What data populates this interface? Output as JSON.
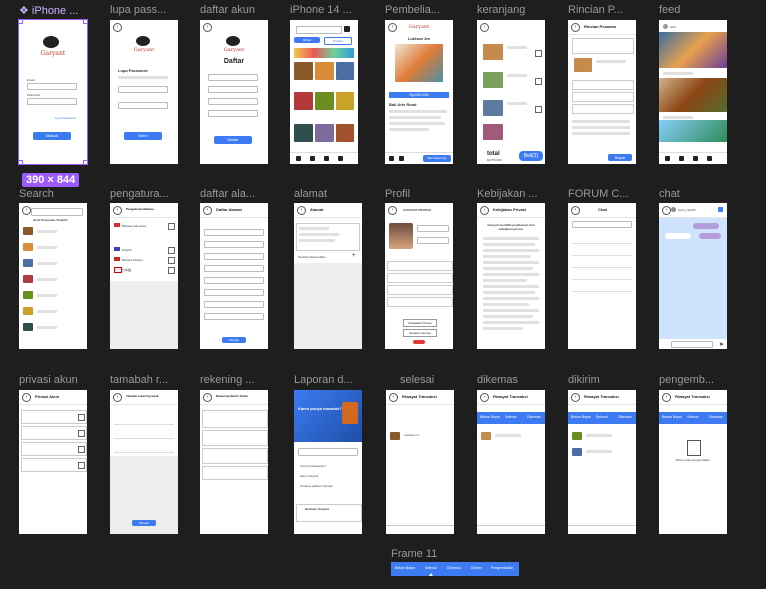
{
  "canvas": {
    "selected_size": "390 × 844",
    "row1": [
      {
        "label": "❖ iPhone ..."
      },
      {
        "label": "lupa pass..."
      },
      {
        "label": "daftar akun"
      },
      {
        "label": "iPhone 14 ..."
      },
      {
        "label": "Pembelia..."
      },
      {
        "label": "keranjang"
      },
      {
        "label": "Rincian P..."
      },
      {
        "label": "feed"
      }
    ],
    "row2": [
      {
        "label": "Search"
      },
      {
        "label": "pengatura..."
      },
      {
        "label": "daftar ala..."
      },
      {
        "label": "alamat"
      },
      {
        "label": "Profil"
      },
      {
        "label": "Kebijakan ..."
      },
      {
        "label": "FORUM C..."
      },
      {
        "label": "chat"
      }
    ],
    "row3": [
      {
        "label": "privasi akun"
      },
      {
        "label": "tamabah r..."
      },
      {
        "label": "rekening ..."
      },
      {
        "label": "Laporan d..."
      },
      {
        "label": "selesai"
      },
      {
        "label": "dikemas"
      },
      {
        "label": "dikirim"
      },
      {
        "label": "pengemb..."
      }
    ],
    "frame11": {
      "label": "Frame 11",
      "tabs": [
        "Belum Bayar",
        "Selesai",
        "Dikemas",
        "Dikirim",
        "Pengembalian"
      ]
    }
  },
  "screens": {
    "login": {
      "brand": "Garyant",
      "btn": "Masuk",
      "forgot": "Lupa Password",
      "email_label": "Email",
      "password_label": "Password"
    },
    "forgot": {
      "brand": "Garyant",
      "title": "Lupa Password",
      "btn": "Kirim"
    },
    "daftar": {
      "brand": "Garyant",
      "title": "Daftar",
      "btn": "Daftar"
    },
    "home": {
      "search": "Cari",
      "tab1": "Dilihat",
      "tab2": "Terbaru"
    },
    "pembelian": {
      "brand": "Garyant",
      "title": "Lukisan 2m",
      "price": "Rp250.000",
      "shop": "Bali Arts Road",
      "btn": "Beli Sekarang"
    },
    "keranjang": {
      "title": "keranjang",
      "total": "total",
      "total_val": "Rp750.000",
      "btn": "Beli(2)"
    },
    "rincian": {
      "title": "Rincian Pesanan",
      "btn": "Bayar"
    },
    "feed": {
      "user": "Sisil"
    },
    "search": {
      "title": "Hasil Pencarian Terakhir"
    },
    "pengaturan": {
      "title": "Pengaturan Bahasa",
      "opt1": "Bahasa Indonesia",
      "opt2": "English",
      "opt3": "Bahasa Melayu",
      "opt4": "日本語"
    },
    "daftaralamat": {
      "title": "Daftar Alamat",
      "btn": "Simpan"
    },
    "alamat": {
      "title": "Alamat",
      "add": "Tambah Alamat Baru"
    },
    "profil": {
      "title": "GARYANT PROFILE",
      "btn1": "Kebijakan Privasi",
      "btn2": "Setelan Lainnya"
    },
    "kebijakan": {
      "title": "Kebijakan Privasi",
      "heading": "Garyant memiliki pembaruan dan kebijakan privasi"
    },
    "forum": {
      "title": "Chat"
    },
    "chat": {
      "user": "Garry_SHOP"
    },
    "privasi": {
      "title": "Privasi Akun"
    },
    "tambahrek": {
      "title": "Tambah rekening bank",
      "btn": "Simpan"
    },
    "rekening": {
      "title": "Rekening Bank / Kartu"
    },
    "laporan": {
      "banner": "Kamu punya masalah?",
      "item1": "Cara Pembayaran?",
      "item2": "Akun Garyant",
      "item3": "Tentang aplikasi Garyant",
      "footer": "Bantuan Garyant"
    },
    "selesai": {
      "title": "Riwayat Transaksi",
      "item": "Lukisan 2m"
    },
    "dikemas": {
      "title": "Riwayat Transaksi",
      "tab_a": "Belum Bayar",
      "tab_b": "Selesai",
      "tab_c": "Dikemas"
    },
    "dikirim": {
      "title": "Riwayat Transaksi",
      "tab_a": "Belum Bayar",
      "tab_b": "Selesai",
      "tab_c": "Dikemas"
    },
    "pengembalian": {
      "title": "Riwayat Transaksi",
      "tab_a": "Belum Bayar",
      "tab_b": "Selesai",
      "tab_c": "Dikemas",
      "empty": "Belum ada pengembalian"
    }
  },
  "colors": {
    "accent": "#3d7bf2",
    "selection": "#9b5cff",
    "canvas": "#1e1e1e",
    "brand_red": "#c0392b"
  }
}
